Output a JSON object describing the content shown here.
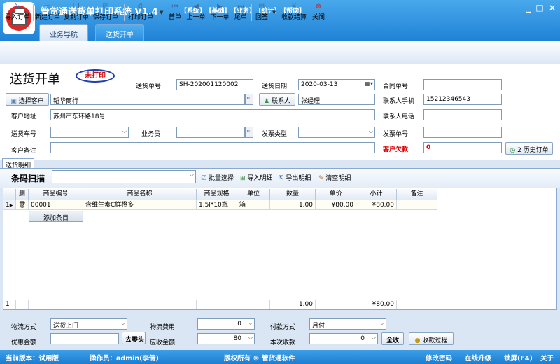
{
  "app": {
    "title": "管货通送货单打印系统 V1.4",
    "menu": [
      "【系统】",
      "【基础】",
      "【业务】",
      "【统计】",
      "【帮助】"
    ],
    "window_controls": [
      "_",
      "□",
      "×"
    ]
  },
  "main_tabs": [
    {
      "label": "业务导航",
      "active": false
    },
    {
      "label": "送货开单",
      "active": true
    }
  ],
  "toolbar": [
    {
      "label": "导入订单",
      "icon": "import-icon"
    },
    {
      "label": "新建订单",
      "icon": "new-document-icon"
    },
    {
      "label": "复制订单",
      "icon": "copy-icon"
    },
    {
      "label": "保存订单",
      "icon": "save-icon"
    },
    {
      "label": "打印订单",
      "icon": "printer-icon"
    },
    {
      "label": "首单",
      "icon": "first-icon"
    },
    {
      "label": "上一单",
      "icon": "previous-icon"
    },
    {
      "label": "下一单",
      "icon": "next-icon"
    },
    {
      "label": "尾单",
      "icon": "last-icon"
    },
    {
      "label": "回签",
      "icon": "sign-back-icon"
    },
    {
      "label": "收款结算",
      "icon": "money-icon"
    },
    {
      "label": "关闭",
      "icon": "close-icon"
    }
  ],
  "form": {
    "title": "送货开单",
    "stamp": "未打印",
    "order_no_label": "送货单号",
    "order_no": "SH-202001120002",
    "date_label": "送货日期",
    "date": "2020-03-13",
    "contract_label": "合同单号",
    "contract": "",
    "select_customer_btn": "选择客户",
    "customer": "韬华商行",
    "contact_btn": "联系人",
    "contact": "张经理",
    "mobile_label": "联系人手机",
    "mobile": "15212346543",
    "address_label": "客户地址",
    "address": "苏州市东环路18号",
    "phone_label": "联系人电话",
    "phone": "",
    "vehicle_label": "送货车号",
    "vehicle": "",
    "salesman_label": "业务员",
    "salesman": "",
    "invoice_type_label": "发票类型",
    "invoice_type": "",
    "invoice_no_label": "发票单号",
    "invoice_no": "",
    "remark_label": "客户备注",
    "remark": "",
    "debt_label": "客户欠款",
    "debt": "0",
    "history_btn": "2 历史订单"
  },
  "detail_tab": "送货明细",
  "scan": {
    "label": "条码扫描",
    "value": "",
    "actions": [
      "批量选择",
      "导入明细",
      "导出明细",
      "清空明细"
    ]
  },
  "grid": {
    "columns": [
      "删",
      "商品编号",
      "商品名称",
      "商品规格",
      "单位",
      "数量",
      "单价",
      "小计",
      "备注"
    ],
    "rows": [
      {
        "index": "1",
        "code": "00001",
        "name": "含维生素C鲜橙多",
        "spec": "1.5l*10瓶",
        "unit": "箱",
        "qty": "1.00",
        "price": "¥80.00",
        "subtotal": "¥80.00",
        "note": ""
      }
    ],
    "add_row": "添加条目",
    "footer": {
      "index": "1",
      "qty": "1.00",
      "subtotal": "¥80.00"
    }
  },
  "bottom": {
    "logistics_label": "物流方式",
    "logistics": "送货上门",
    "freight_label": "物流费用",
    "freight": "0",
    "payment_label": "付款方式",
    "payment": "月付",
    "discount_label": "优惠金额",
    "discount": "",
    "round_btn": "去零头",
    "receivable_label": "应收金额",
    "receivable": "80",
    "received_label": "本次收款",
    "received": "0",
    "all_btn": "全收",
    "process_btn": "收款过程"
  },
  "status": {
    "version": "当前版本：试用版",
    "operator": "操作员：admin(李倩)",
    "copyright": "版权所有 ® 管货通软件",
    "links": [
      "修改密码",
      "在线升级",
      "锁屏(F4)",
      "关于"
    ]
  }
}
